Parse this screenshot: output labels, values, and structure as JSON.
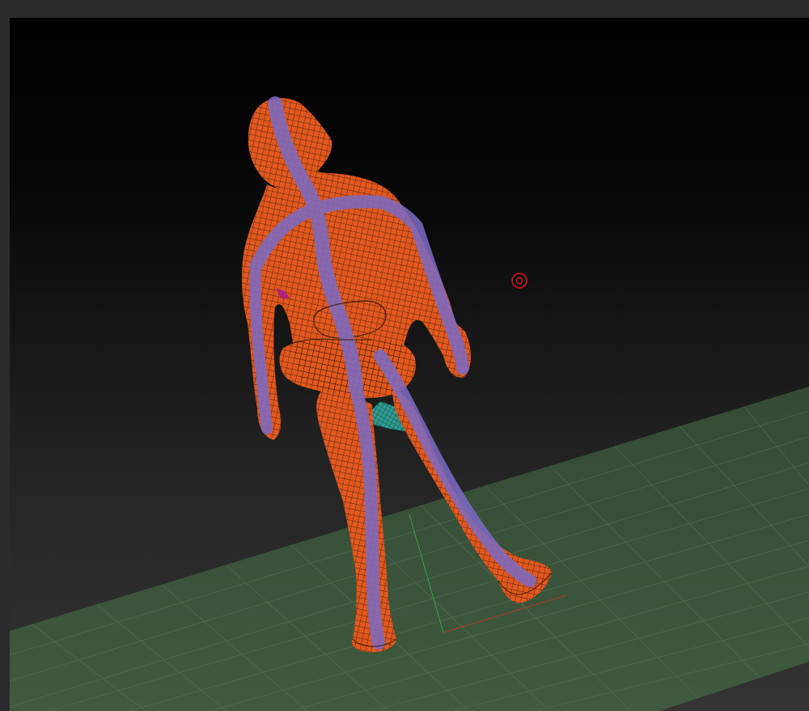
{
  "app": {
    "name": "",
    "viewport": {
      "label": ""
    }
  },
  "scene": {
    "model_icon": "humanoid-mesh-model",
    "ground_icon": "ground-grid",
    "pivot_icon": "rotation-pivot-marker",
    "background_top": "#000000",
    "background_bottom": "#343434",
    "mesh_color": "#e2581e",
    "wire_color": "#3a1a08",
    "polygroup_color": "#7b6bc6",
    "hidden_part_color": "#2f9c93",
    "grid_color": "#3f5a3e",
    "grid_line_color": "#5a7a58",
    "pivot_color": "#d21a1a",
    "axis_x_color": "#b03a2a",
    "axis_z_color": "#3aa24a"
  }
}
